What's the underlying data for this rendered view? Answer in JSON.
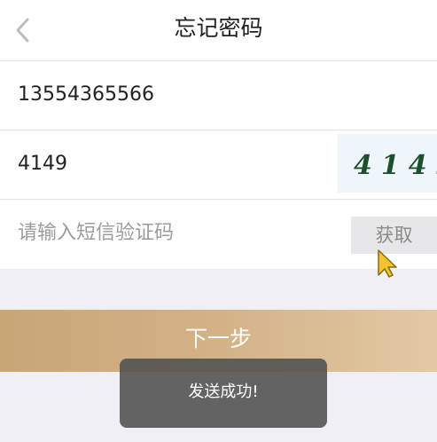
{
  "header": {
    "title": "忘记密码",
    "back_icon": "chevron-left-icon"
  },
  "form": {
    "phone_value": "13554365566",
    "captcha_value": "4149",
    "captcha_image_text": "4149",
    "sms_code_placeholder": "请输入短信验证码",
    "get_code_label": "获取"
  },
  "next_button_label": "下一步",
  "toast_text": "发送成功!",
  "colors": {
    "accent_gold": "#d3b287",
    "cursor": "#f2c530"
  }
}
